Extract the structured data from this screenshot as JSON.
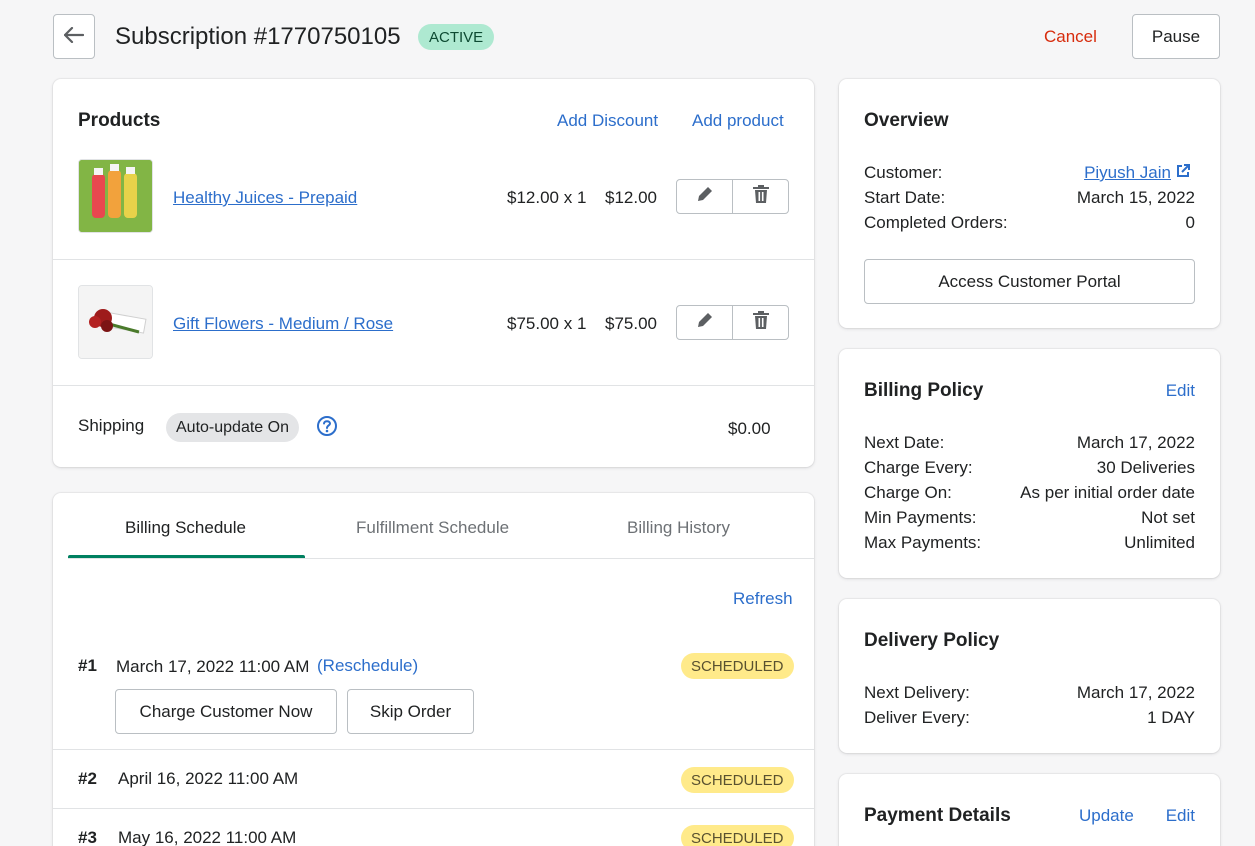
{
  "header": {
    "title": "Subscription #1770750105",
    "status": "ACTIVE",
    "cancel_label": "Cancel",
    "pause_label": "Pause"
  },
  "products": {
    "title": "Products",
    "add_discount_label": "Add Discount",
    "add_product_label": "Add product",
    "items": [
      {
        "name": "Healthy Juices - Prepaid",
        "unit_qty": "$12.00 x 1",
        "total": "$12.00"
      },
      {
        "name": "Gift Flowers - Medium / Rose",
        "unit_qty": "$75.00 x 1",
        "total": "$75.00"
      }
    ],
    "shipping_label": "Shipping",
    "shipping_chip": "Auto-update On",
    "shipping_amount": "$0.00"
  },
  "schedule": {
    "tabs": [
      "Billing Schedule",
      "Fulfillment Schedule",
      "Billing History"
    ],
    "active_tab": 0,
    "refresh_label": "Refresh",
    "rows": [
      {
        "index": "#1",
        "date": "March 17, 2022 11:00 AM",
        "reschedule": "(Reschedule)",
        "status": "SCHEDULED"
      },
      {
        "index": "#2",
        "date": "April 16, 2022 11:00 AM",
        "status": "SCHEDULED"
      },
      {
        "index": "#3",
        "date": "May 16, 2022 11:00 AM",
        "status": "SCHEDULED"
      }
    ],
    "charge_now_label": "Charge Customer Now",
    "skip_order_label": "Skip Order"
  },
  "overview": {
    "title": "Overview",
    "customer_label": "Customer:",
    "customer_value": "Piyush Jain",
    "start_date_label": "Start Date:",
    "start_date_value": "March 15, 2022",
    "completed_label": "Completed Orders:",
    "completed_value": "0",
    "portal_label": "Access Customer Portal"
  },
  "billing_policy": {
    "title": "Billing Policy",
    "edit_label": "Edit",
    "rows": [
      {
        "label": "Next Date:",
        "value": "March 17, 2022"
      },
      {
        "label": "Charge Every:",
        "value": "30 Deliveries"
      },
      {
        "label": "Charge On:",
        "value": "As per initial order date"
      },
      {
        "label": "Min Payments:",
        "value": "Not set"
      },
      {
        "label": "Max Payments:",
        "value": "Unlimited"
      }
    ]
  },
  "delivery_policy": {
    "title": "Delivery Policy",
    "rows": [
      {
        "label": "Next Delivery:",
        "value": "March 17, 2022"
      },
      {
        "label": "Deliver Every:",
        "value": "1 DAY"
      }
    ]
  },
  "payment_details": {
    "title": "Payment Details",
    "update_label": "Update",
    "edit_label": "Edit"
  },
  "colors": {
    "link": "#2c6ecb",
    "danger": "#d72c0d",
    "active_badge": "#aee9d1",
    "scheduled_badge": "#ffea8a",
    "tab_active": "#008060"
  }
}
